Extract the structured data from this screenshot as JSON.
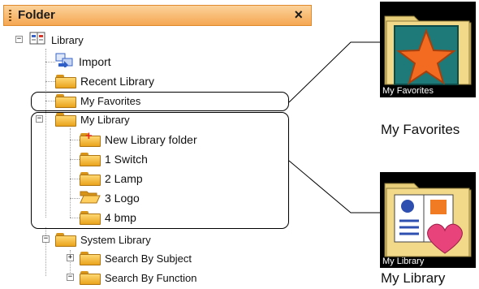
{
  "folder_panel": {
    "title": "Folder",
    "close_glyph": "×",
    "tree": {
      "root": "Library",
      "import": "Import",
      "recent": "Recent Library",
      "favorites": "My Favorites",
      "my_library": "My Library",
      "new_folder": "New Library folder",
      "child_1": "1 Switch",
      "child_2": "2 Lamp",
      "child_3": "3 Logo",
      "child_4": "4 bmp",
      "system": "System Library",
      "subject": "Search By Subject",
      "function": "Search By Function"
    }
  },
  "previews": {
    "favorites": {
      "caption": "My Favorites",
      "label": "My Favorites"
    },
    "my_library": {
      "caption": "My Library",
      "label": "My Library"
    }
  },
  "colors": {
    "header_gradient_top": "#fbd29a",
    "header_gradient_bottom": "#f5a752",
    "folder": "#f2b93b",
    "star": "#f26b21"
  }
}
